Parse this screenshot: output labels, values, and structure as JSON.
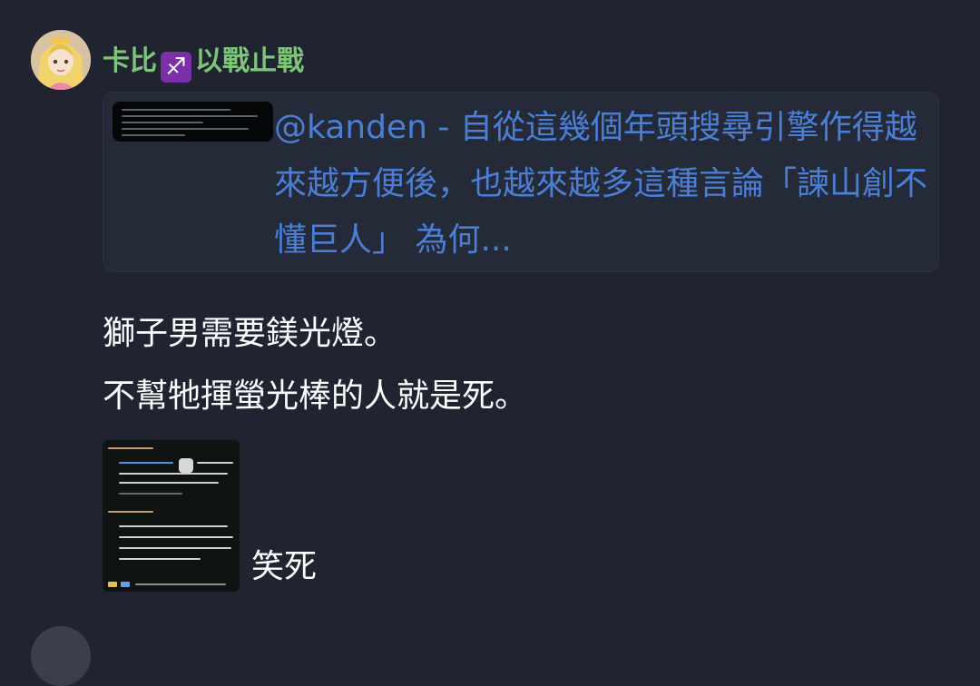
{
  "post": {
    "author": {
      "name_part1": "卡比",
      "zodiac_icon": "sagittarius-icon",
      "zodiac_symbol": "♐",
      "name_part2": "以戰止戰",
      "name_color": "#7ec47a"
    },
    "quote": {
      "text": "@kanden - 自從這幾個年頭搜尋引擎作得越來越方便後，也越來越多這種言論「諫山創不懂巨人」 為何...",
      "link_color": "#4b7fd6"
    },
    "body_lines": [
      "獅子男需要鎂光燈。",
      "不幫牠揮螢光棒的人就是死。"
    ],
    "caption": "笑死"
  },
  "colors": {
    "background": "#1f2430",
    "quote_background": "#242a37",
    "text": "#ffffff"
  }
}
